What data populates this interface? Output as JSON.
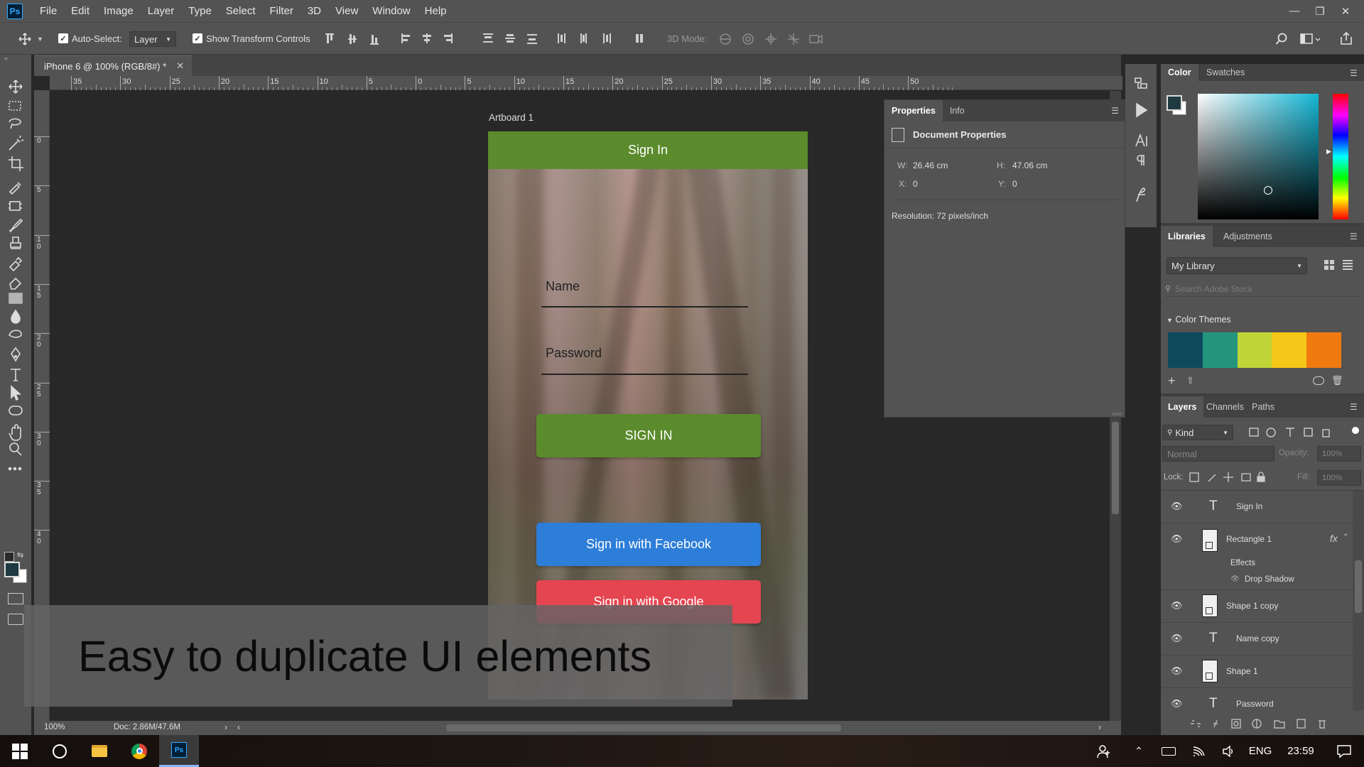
{
  "app": {
    "logo": "Ps"
  },
  "menu": [
    "File",
    "Edit",
    "Image",
    "Layer",
    "Type",
    "Select",
    "Filter",
    "3D",
    "View",
    "Window",
    "Help"
  ],
  "options": {
    "auto_select_label": "Auto-Select:",
    "auto_select_value": "Layer",
    "show_transform_label": "Show Transform Controls",
    "mode_3d_label": "3D Mode:"
  },
  "document": {
    "tab_title": "iPhone 6 @ 100% (RGB/8#) *",
    "artboard_label": "Artboard 1",
    "zoom": "100%",
    "doc_info": "Doc: 2.86M/47.6M"
  },
  "ruler": {
    "top": [
      "35",
      "30",
      "25",
      "20",
      "15",
      "10",
      "5",
      "0",
      "5",
      "10",
      "15",
      "20",
      "25",
      "30",
      "35",
      "40",
      "45",
      "50"
    ],
    "left": [
      "0",
      "5",
      "1\n0",
      "1\n5",
      "2\n0",
      "2\n5",
      "3\n0",
      "3\n5",
      "4\n0"
    ]
  },
  "artboard": {
    "header_title": "Sign In",
    "name_label": "Name",
    "password_label": "Password",
    "signin_button": "SIGN IN",
    "facebook_button": "Sign in with Facebook",
    "google_button": "Sign in with Google",
    "colors": {
      "green": "#5b8b2c",
      "facebook": "#2d7ed8",
      "google": "#e54550"
    }
  },
  "properties": {
    "tabs": [
      "Properties",
      "Info"
    ],
    "section_title": "Document Properties",
    "w_label": "W:",
    "w_value": "26.46 cm",
    "h_label": "H:",
    "h_value": "47.06 cm",
    "x_label": "X:",
    "x_value": "0",
    "y_label": "Y:",
    "y_value": "0",
    "resolution": "Resolution: 72 pixels/inch"
  },
  "color_panel": {
    "tabs": [
      "Color",
      "Swatches"
    ]
  },
  "libraries": {
    "tabs": [
      "Libraries",
      "Adjustments"
    ],
    "library": "My Library",
    "search_placeholder": "Search Adobe Stock",
    "color_themes": "Color Themes",
    "theme_colors": [
      "#0e4a5e",
      "#24957c",
      "#bfd437",
      "#f5c719",
      "#f07a10"
    ]
  },
  "layers_panel": {
    "tabs": [
      "Layers",
      "Channels",
      "Paths"
    ],
    "kind": "Kind",
    "blend_mode": "Normal",
    "opacity_label": "Opacity:",
    "opacity_value": "100%",
    "lock_label": "Lock:",
    "fill_label": "Fill:",
    "fill_value": "100%",
    "layers": [
      {
        "name": "Sign In",
        "kind": "text"
      },
      {
        "name": "Rectangle 1",
        "kind": "shape",
        "fx": "fx"
      },
      {
        "name": "Shape 1 copy",
        "kind": "shape"
      },
      {
        "name": "Name copy",
        "kind": "text"
      },
      {
        "name": "Shape 1",
        "kind": "shape"
      },
      {
        "name": "Password",
        "kind": "text"
      }
    ],
    "effects_label": "Effects",
    "drop_shadow": "Drop Shadow"
  },
  "caption": "Easy to duplicate UI elements",
  "taskbar": {
    "lang": "ENG",
    "time": "23:59"
  }
}
